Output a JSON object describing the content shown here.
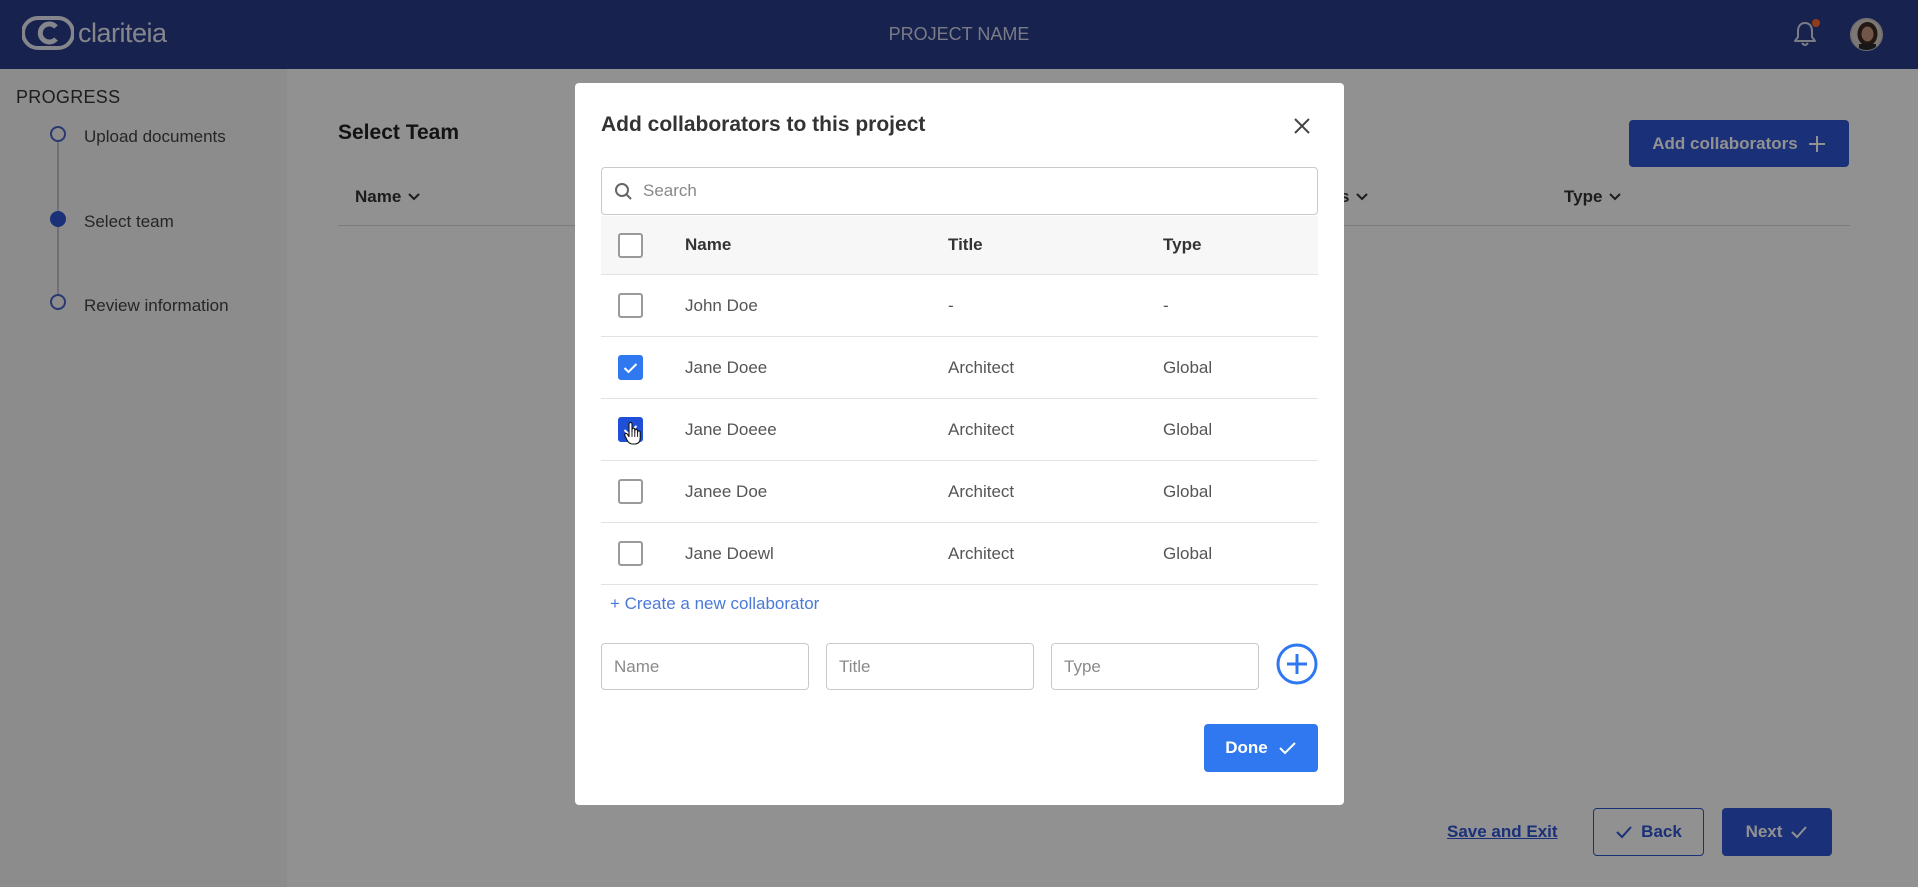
{
  "header": {
    "logo_text": "clariteia",
    "project_name": "PROJECT NAME",
    "bell_icon": "bell-icon",
    "notification_badge_color": "#ff6a2a"
  },
  "sidebar": {
    "title": "PROGRESS",
    "steps": [
      {
        "label": "Upload documents",
        "state": "incomplete"
      },
      {
        "label": "Select team",
        "state": "current"
      },
      {
        "label": "Review information",
        "state": "incomplete"
      }
    ]
  },
  "main": {
    "title": "Select Team",
    "add_button_label": "Add collaborators",
    "columns": [
      "Name",
      "s",
      "Type"
    ],
    "save_exit_label": "Save and Exit",
    "back_label": "Back",
    "next_label": "Next"
  },
  "modal": {
    "title": "Add collaborators to this project",
    "search_placeholder": "Search",
    "table_headers": {
      "name": "Name",
      "title": "Title",
      "type": "Type"
    },
    "rows": [
      {
        "name": "John Doe",
        "title": "-",
        "type": "-",
        "checked": false
      },
      {
        "name": "Jane Doee",
        "title": "Architect",
        "type": "Global",
        "checked": true
      },
      {
        "name": "Jane Doeee",
        "title": "Architect",
        "type": "Global",
        "checked": true
      },
      {
        "name": "Janee Doe",
        "title": "Architect",
        "type": "Global",
        "checked": false
      },
      {
        "name": "Jane Doewl",
        "title": "Architect",
        "type": "Global",
        "checked": false
      }
    ],
    "create_link": "+ Create a new collaborator",
    "new_name_placeholder": "Name",
    "new_title_placeholder": "Title",
    "new_type_placeholder": "Type",
    "done_label": "Done"
  },
  "colors": {
    "header_bg": "#2a3c8c",
    "primary": "#2f55d4",
    "modal_accent": "#2f78f0"
  }
}
